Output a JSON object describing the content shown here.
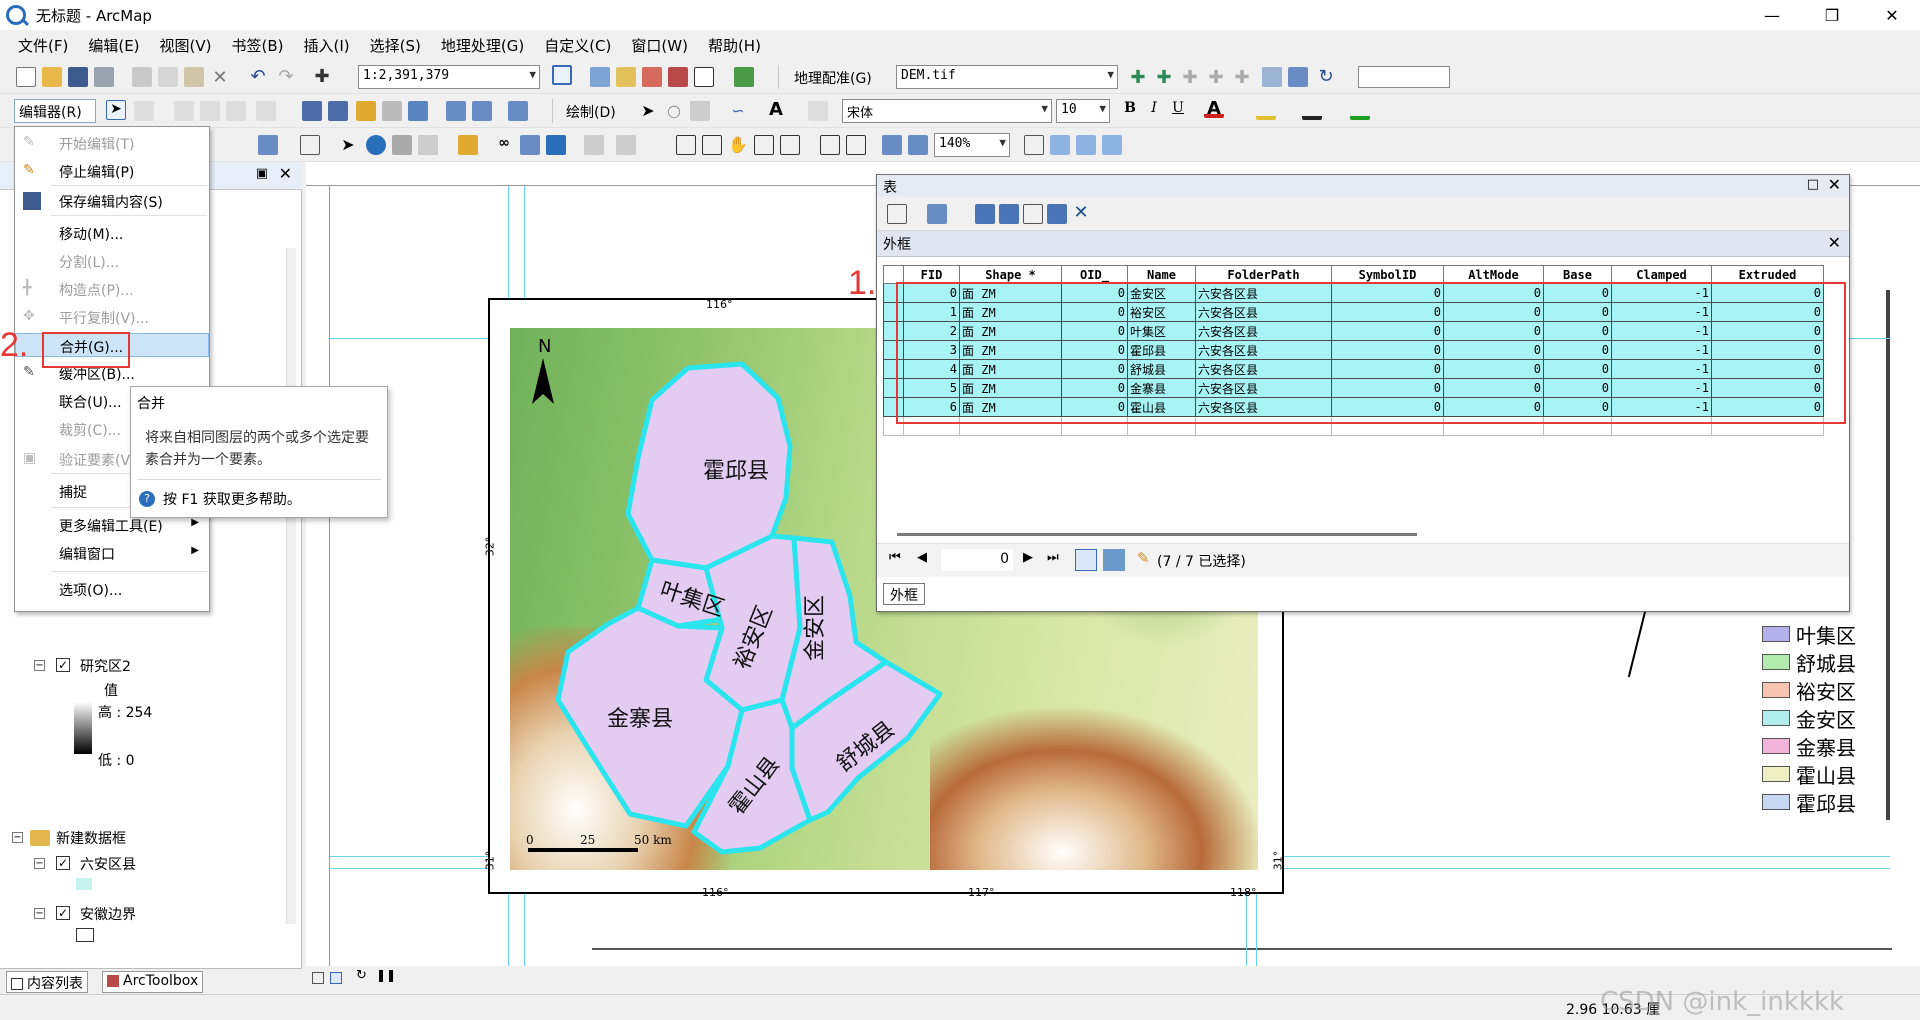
{
  "window": {
    "title": "无标题 - ArcMap"
  },
  "menubar": [
    "文件(F)",
    "编辑(E)",
    "视图(V)",
    "书签(B)",
    "插入(I)",
    "选择(S)",
    "地理处理(G)",
    "自定义(C)",
    "窗口(W)",
    "帮助(H)"
  ],
  "toolbar1": {
    "scale": "1:2,391,379",
    "georef_label": "地理配准(G)",
    "georef_layer": "DEM.tif"
  },
  "toolbar2": {
    "editor_label": "编辑器(R)",
    "draw_label": "绘制(D)",
    "font": "宋体",
    "font_size": "10"
  },
  "toolbar3": {
    "zoom": "140%"
  },
  "editor_menu": {
    "items": [
      {
        "label": "开始编辑(T)",
        "disabled": true
      },
      {
        "label": "停止编辑(P)",
        "disabled": false
      },
      {
        "label": "保存编辑内容(S)",
        "disabled": false
      },
      {
        "label": "移动(M)...",
        "disabled": false
      },
      {
        "label": "分割(L)...",
        "disabled": true
      },
      {
        "label": "构造点(P)...",
        "disabled": true
      },
      {
        "label": "平行复制(V)...",
        "disabled": true
      },
      {
        "label": "合并(G)...",
        "disabled": false
      },
      {
        "label": "缓冲区(B)...",
        "disabled": false
      },
      {
        "label": "联合(U)...",
        "disabled": false
      },
      {
        "label": "裁剪(C)...",
        "disabled": true
      },
      {
        "label": "验证要素(V)",
        "disabled": true
      },
      {
        "label": "捕捉",
        "disabled": false
      },
      {
        "label": "更多编辑工具(E)",
        "disabled": false
      },
      {
        "label": "编辑窗口",
        "disabled": false
      },
      {
        "label": "选项(O)...",
        "disabled": false
      }
    ]
  },
  "tooltip": {
    "title": "合并",
    "body": "将来自相同图层的两个或多个选定要素合并为一个要素。",
    "help": "按 F1 获取更多帮助。"
  },
  "toc": {
    "layer_raster": "研究区2",
    "value_label": "值",
    "high": "高 : 254",
    "low": "低 : 0",
    "frame_label": "新建数据框",
    "layer_counties": "六安区县",
    "layer_border": "安徽边界",
    "tabs": [
      "内容列表",
      "ArcToolbox"
    ]
  },
  "table_window": {
    "title": "表",
    "table_name": "外框",
    "columns": [
      "FID",
      "Shape *",
      "OID_",
      "Name",
      "FolderPath",
      "SymbolID",
      "AltMode",
      "Base",
      "Clamped",
      "Extruded"
    ],
    "rows": [
      [
        "0",
        "面 ZM",
        "0",
        "金安区",
        "六安各区县",
        "0",
        "0",
        "0",
        "-1",
        "0"
      ],
      [
        "1",
        "面 ZM",
        "0",
        "裕安区",
        "六安各区县",
        "0",
        "0",
        "0",
        "-1",
        "0"
      ],
      [
        "2",
        "面 ZM",
        "0",
        "叶集区",
        "六安各区县",
        "0",
        "0",
        "0",
        "-1",
        "0"
      ],
      [
        "3",
        "面 ZM",
        "0",
        "霍邱县",
        "六安各区县",
        "0",
        "0",
        "0",
        "-1",
        "0"
      ],
      [
        "4",
        "面 ZM",
        "0",
        "舒城县",
        "六安各区县",
        "0",
        "0",
        "0",
        "-1",
        "0"
      ],
      [
        "5",
        "面 ZM",
        "0",
        "金寨县",
        "六安各区县",
        "0",
        "0",
        "0",
        "-1",
        "0"
      ],
      [
        "6",
        "面 ZM",
        "0",
        "霍山县",
        "六安各区县",
        "0",
        "0",
        "0",
        "-1",
        "0"
      ]
    ],
    "record_index": "0",
    "selection_text": "(7 / 7 已选择)",
    "bottom_tab": "外框"
  },
  "annotations": {
    "step1": "1.",
    "step2": "2."
  },
  "map": {
    "north": "N",
    "counties": [
      "霍邱县",
      "叶集区",
      "裕安区",
      "金安区",
      "金寨县",
      "霍山县",
      "舒城县"
    ],
    "top_lon": "116°",
    "bottom_lons": [
      "116°",
      "117°",
      "118°"
    ],
    "left_lat": "32°",
    "bottom_lat": "31°",
    "right_lat": "31°",
    "scalebar": [
      "0",
      "25",
      "50 km"
    ]
  },
  "legend": [
    {
      "label": "叶集区",
      "color": "#b4b0ec"
    },
    {
      "label": "舒城县",
      "color": "#b4ecb0"
    },
    {
      "label": "裕安区",
      "color": "#f6c4b0"
    },
    {
      "label": "金安区",
      "color": "#b0eeee"
    },
    {
      "label": "金寨县",
      "color": "#f2b4d8"
    },
    {
      "label": "霍山县",
      "color": "#eef0c4"
    },
    {
      "label": "霍邱县",
      "color": "#c8d8f4"
    }
  ],
  "status": {
    "coords": "2.96  10.63 厘"
  },
  "watermark": "CSDN @ink_inkkkk"
}
